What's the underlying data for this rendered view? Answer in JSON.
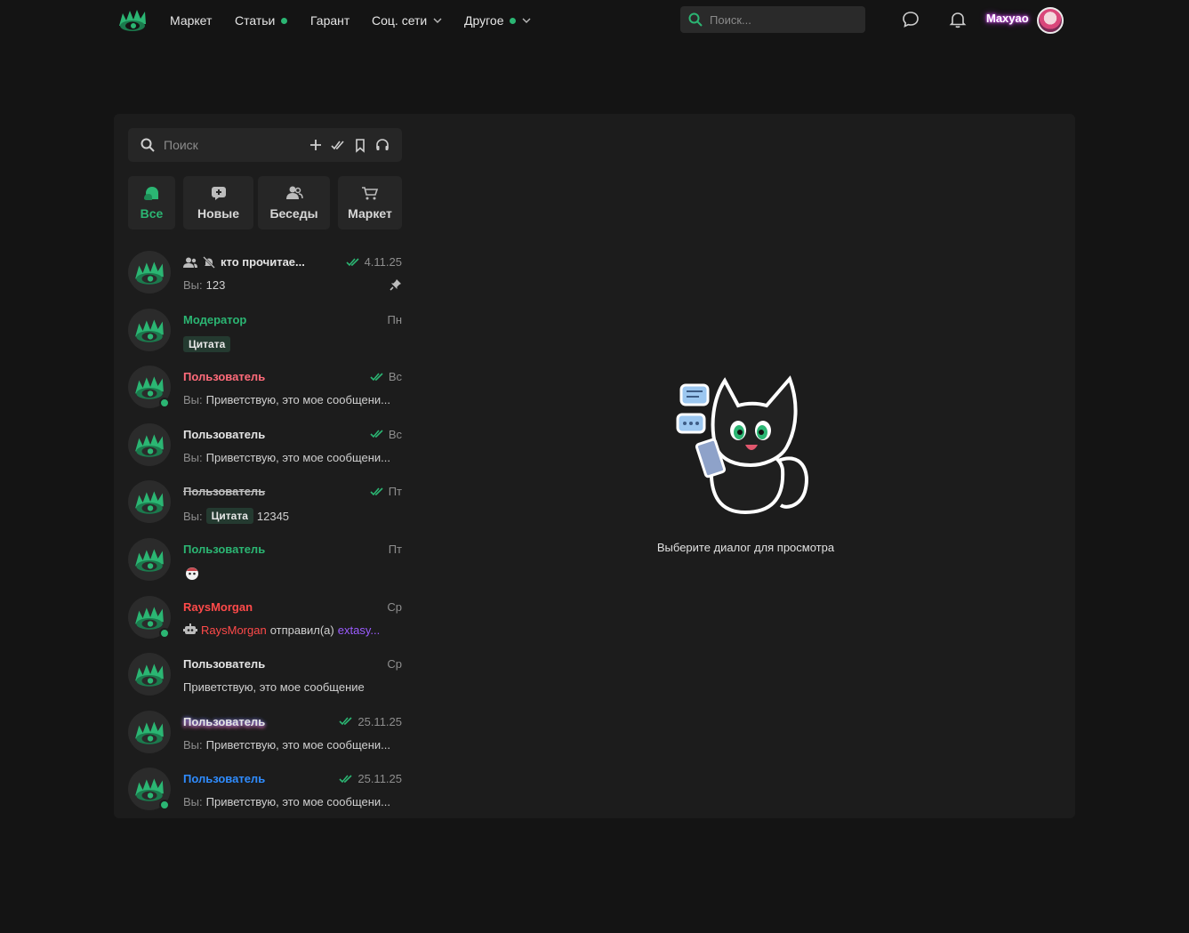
{
  "nav": {
    "items": [
      {
        "label": "Маркет"
      },
      {
        "label": "Статьи"
      },
      {
        "label": "Гарант"
      },
      {
        "label": "Соц. сети"
      },
      {
        "label": "Другое"
      }
    ],
    "search_placeholder": "Поиск...",
    "username": "Maxyao",
    "brand_color": "#2bb673"
  },
  "sidebar": {
    "search_placeholder": "Поиск",
    "filters": [
      {
        "label": "Все",
        "icon": "chat-bubbles-icon",
        "active": true
      },
      {
        "label": "Новые",
        "icon": "new-message-icon"
      },
      {
        "label": "Беседы",
        "icon": "group-icon"
      },
      {
        "label": "Маркет",
        "icon": "cart-icon"
      }
    ],
    "chats": [
      {
        "name": "кто прочитае...",
        "time": "4.11.25",
        "you": "Вы:",
        "text": "123",
        "read": true,
        "pinned": true,
        "muted": true,
        "group": true
      },
      {
        "name": "Модератор",
        "time": "Пн",
        "quote": "Цитата",
        "name_color": "#2bb673"
      },
      {
        "name": "Пользователь",
        "time": "Вс",
        "you": "Вы:",
        "text": "Приветствую, это мое сообщени...",
        "read": true,
        "online": true,
        "name_color": "#ff6b7a"
      },
      {
        "name": "Пользователь",
        "time": "Вс",
        "you": "Вы:",
        "text": "Приветствую, это мое сообщени...",
        "read": true
      },
      {
        "name": "Пользователь",
        "time": "Пт",
        "you": "Вы:",
        "quote": "Цитата",
        "text": "12345",
        "read": true,
        "strike": true
      },
      {
        "name": "Пользователь",
        "time": "Пт",
        "emoji": true,
        "name_color": "#2bb673"
      },
      {
        "name": "RaysMorgan",
        "time": "Ср",
        "bot": true,
        "sender": "RaysMorgan",
        "text": "отправил(а)",
        "link": "extasy...",
        "online": true,
        "name_color": "#ff4a4a"
      },
      {
        "name": "Пользователь",
        "time": "Ср",
        "text": "Приветствую, это мое сообщение"
      },
      {
        "name": "Пользователь",
        "time": "25.11.25",
        "you": "Вы:",
        "text": "Приветствую, это мое сообщени...",
        "read": true,
        "glow": true
      },
      {
        "name": "Пользователь",
        "time": "25.11.25",
        "you": "Вы:",
        "text": "Приветствую, это мое сообщени...",
        "read": true,
        "online": true,
        "name_color": "#2f8cff"
      }
    ]
  },
  "empty_state": {
    "text": "Выберите диалог для просмотра"
  }
}
